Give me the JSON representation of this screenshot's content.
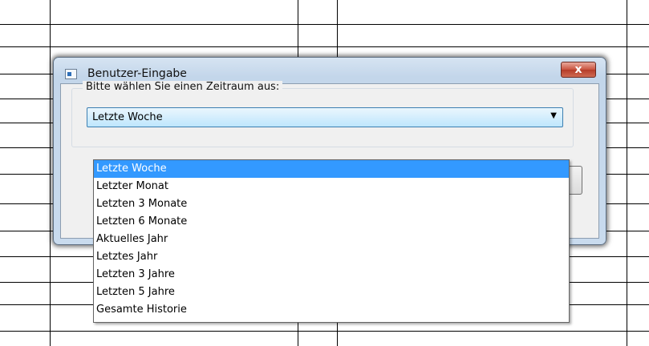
{
  "dialog": {
    "title": "Benutzer-Eingabe",
    "close_label": "x",
    "group_label": "Bitte wählen Sie einen Zeitraum aus:",
    "combo": {
      "selected": "Letzte Woche",
      "arrow": "▼"
    }
  },
  "dropdown": {
    "items": [
      "Letzte Woche",
      "Letzter Monat",
      "Letzten 3 Monate",
      "Letzten 6 Monate",
      "Aktuelles Jahr",
      "Letztes Jahr",
      "Letzten 3 Jahre",
      "Letzten 5 Jahre",
      "Gesamte Historie"
    ],
    "highlighted_index": 0
  },
  "colors": {
    "selection": "#3399ff",
    "close_button": "#c9533f",
    "combo_border": "#3c7fb1"
  }
}
